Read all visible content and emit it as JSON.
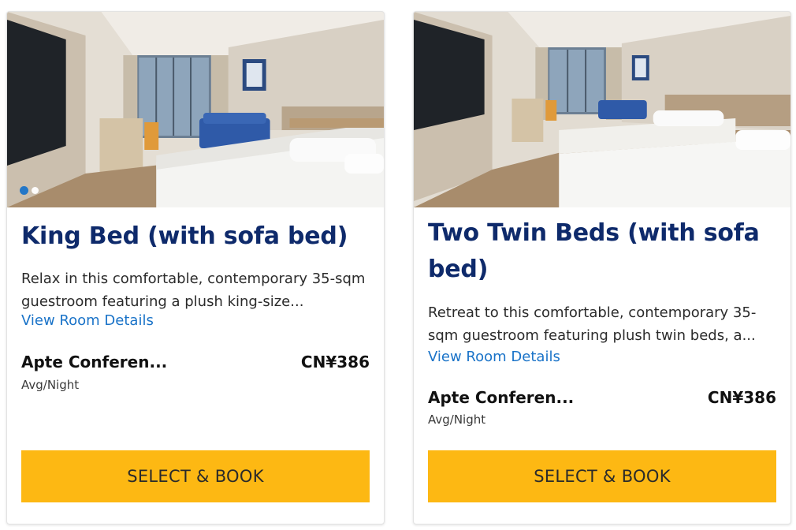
{
  "rooms": [
    {
      "title": "King Bed (with sofa bed)",
      "description": "Relax in this comfortable, contemporary 35-sqm guestroom featuring a plush king-size...",
      "details_link": "View Room Details",
      "rate_name": "Apte Conferen...",
      "price": "CN¥386",
      "price_unit": "Avg/Night",
      "button_label": "SELECT & BOOK",
      "photo_icon": "room-photo-king-bed",
      "carousel": {
        "slides": 2,
        "active": 1
      }
    },
    {
      "title": "Two Twin Beds (with sofa bed)",
      "description": "Retreat to this comfortable, contemporary 35-sqm guestroom featuring plush twin beds, a...",
      "details_link": "View Room Details",
      "rate_name": "Apte Conferen...",
      "price": "CN¥386",
      "price_unit": "Avg/Night",
      "button_label": "SELECT & BOOK",
      "photo_icon": "room-photo-twin-beds"
    }
  ],
  "colors": {
    "title": "#0e2a6b",
    "link": "#1a73c8",
    "button": "#fdb813",
    "dot_active": "#1a73c8"
  }
}
